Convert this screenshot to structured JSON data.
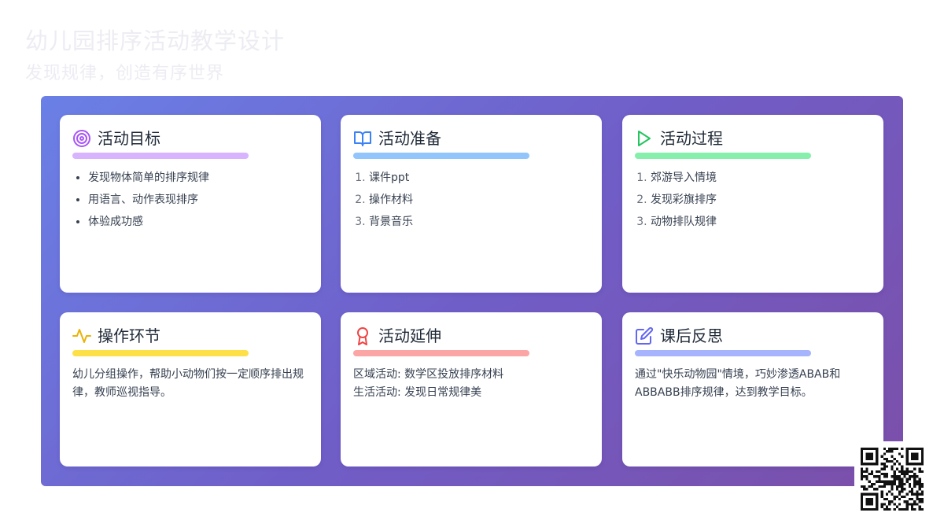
{
  "header": {
    "title": "幼儿园排序活动教学设计",
    "subtitle": "发现规律，创造有序世界"
  },
  "colors": {
    "board_gradient": [
      "#6a80e6",
      "#705ec8",
      "#7b4fa9"
    ],
    "goal_accent": "#a855f7",
    "goal_bar": "#d8b4fe",
    "prep_accent": "#3b82f6",
    "prep_bar": "#93c5fd",
    "process_accent": "#22c55e",
    "process_bar": "#86efac",
    "operate_accent": "#eab308",
    "operate_bar": "#fde047",
    "extend_accent": "#ef4444",
    "extend_bar": "#fca5a5",
    "reflect_accent": "#6366f1",
    "reflect_bar": "#a5b4fc"
  },
  "cards": {
    "goals": {
      "icon": "target-icon",
      "title": "活动目标",
      "items": [
        "发现物体简单的排序规律",
        "用语言、动作表现排序",
        "体验成功感"
      ]
    },
    "preparation": {
      "icon": "book-open-icon",
      "title": "活动准备",
      "items": [
        "课件ppt",
        "操作材料",
        "背景音乐"
      ]
    },
    "process": {
      "icon": "play-icon",
      "title": "活动过程",
      "items": [
        "郊游导入情境",
        "发现彩旗排序",
        "动物排队规律"
      ]
    },
    "operation": {
      "icon": "activity-pulse-icon",
      "title": "操作环节",
      "text": "幼儿分组操作，帮助小动物们按一定顺序排出规律，教师巡视指导。"
    },
    "extension": {
      "icon": "award-ribbon-icon",
      "title": "活动延伸",
      "lines": [
        "区域活动: 数学区投放排序材料",
        "生活活动: 发现日常规律美"
      ]
    },
    "reflection": {
      "icon": "edit-pencil-icon",
      "title": "课后反思",
      "text": "通过\"快乐动物园\"情境，巧妙渗透ABAB和ABBABB排序规律，达到教学目标。"
    }
  },
  "qr": {
    "icon": "qr-code-icon"
  }
}
